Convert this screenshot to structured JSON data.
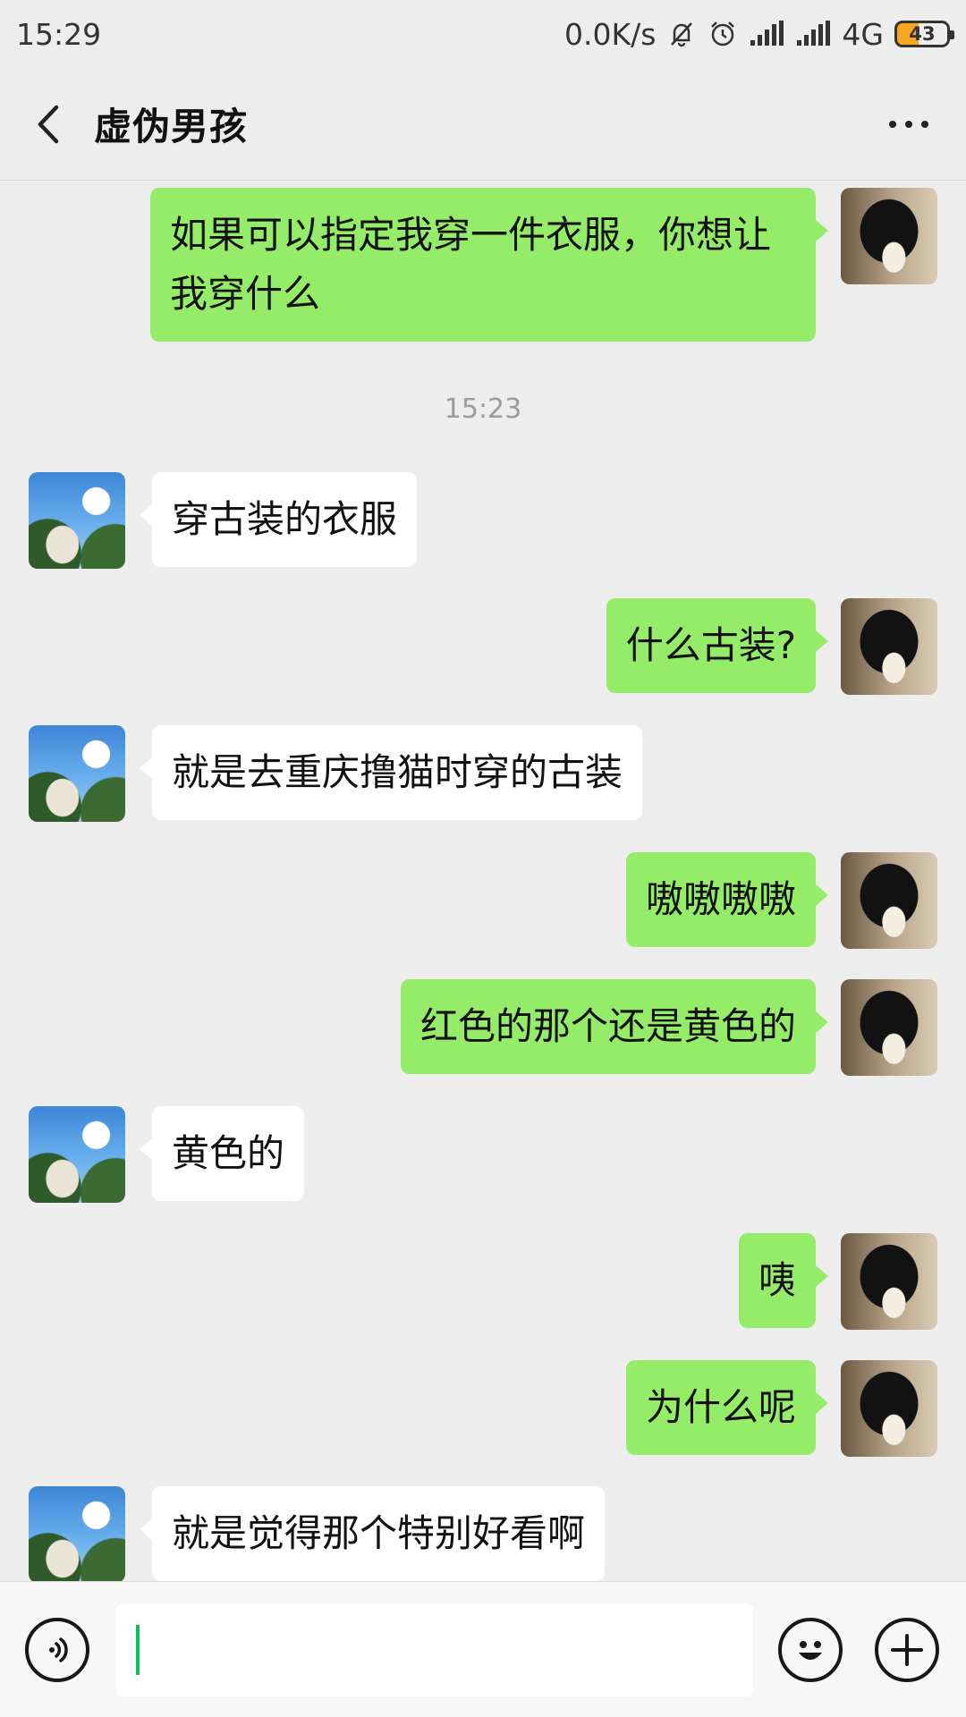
{
  "status_bar": {
    "time": "15:29",
    "network_speed": "0.0K/s",
    "network_type": "4G",
    "battery": "43",
    "icons": [
      "mute-bell-icon",
      "alarm-icon",
      "signal-icon",
      "signal-icon"
    ]
  },
  "header": {
    "title": "虚伪男孩",
    "back_icon": "chevron-left-icon",
    "more_icon": "more-dots-icon"
  },
  "messages": [
    {
      "side": "right",
      "text": "如果可以指定我穿一件衣服，你想让我穿什么"
    },
    {
      "type": "timestamp",
      "text": "15:23"
    },
    {
      "side": "left",
      "text": "穿古装的衣服"
    },
    {
      "side": "right",
      "text": "什么古装?"
    },
    {
      "side": "left",
      "text": "就是去重庆撸猫时穿的古装"
    },
    {
      "side": "right",
      "text": "嗷嗷嗷嗷"
    },
    {
      "side": "right",
      "text": "红色的那个还是黄色的"
    },
    {
      "side": "left",
      "text": "黄色的"
    },
    {
      "side": "right",
      "text": "咦"
    },
    {
      "side": "right",
      "text": "为什么呢"
    },
    {
      "side": "left",
      "text": "就是觉得那个特别好看啊"
    }
  ],
  "input_bar": {
    "voice_icon": "voice-icon",
    "input_value": "",
    "emoji_icon": "emoji-icon",
    "add_icon": "plus-icon"
  },
  "colors": {
    "background": "#ededed",
    "outgoing_bubble": "#95ec69",
    "incoming_bubble": "#ffffff",
    "battery_fill": "#f6a623",
    "cursor": "#07c160"
  }
}
